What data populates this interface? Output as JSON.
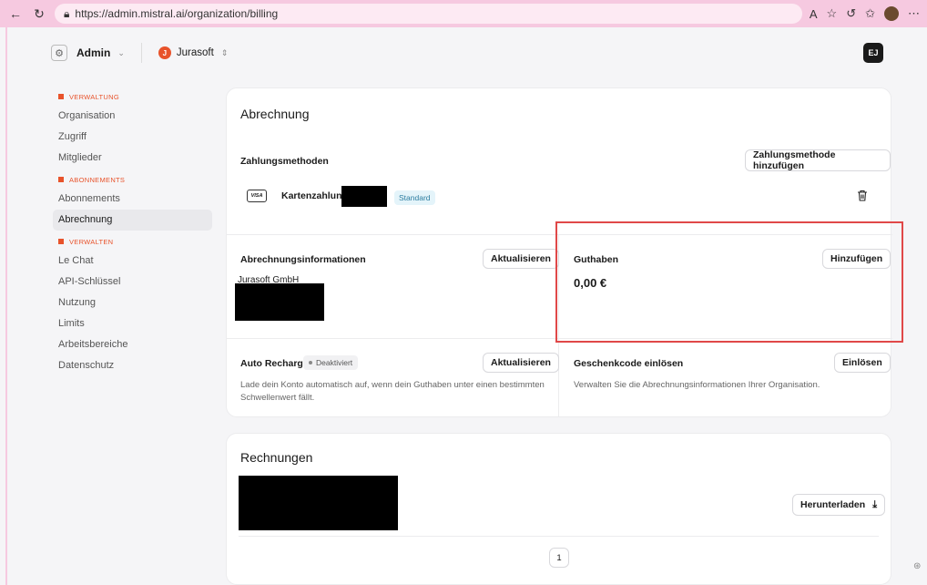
{
  "browser": {
    "url": "https://admin.mistral.ai/organization/billing"
  },
  "topbar": {
    "workspace": "Admin",
    "org_initial": "J",
    "org_name": "Jurasoft",
    "user_initials": "EJ"
  },
  "sidebar": {
    "sections": [
      {
        "title": "VERWALTUNG",
        "items": [
          "Organisation",
          "Zugriff",
          "Mitglieder"
        ]
      },
      {
        "title": "ABONNEMENTS",
        "items": [
          "Abonnements",
          "Abrechnung"
        ]
      },
      {
        "title": "VERWALTEN",
        "items": [
          "Le Chat",
          "API-Schlüssel",
          "Nutzung",
          "Limits",
          "Arbeitsbereiche",
          "Datenschutz"
        ]
      }
    ],
    "active": "Abrechnung"
  },
  "billing": {
    "title": "Abrechnung",
    "payment_methods_label": "Zahlungsmethoden",
    "add_payment_method": "Zahlungsmethode hinzufügen",
    "card_brand": "VISA",
    "card_label": "Kartenzahlung",
    "default_badge": "Standard",
    "billing_info_label": "Abrechnungsinformationen",
    "update_label": "Aktualisieren",
    "company": "Jurasoft GmbH",
    "credit_label": "Guthaben",
    "add_label": "Hinzufügen",
    "credit_amount": "0,00 €",
    "auto_recharge_label": "Auto Recharge",
    "auto_recharge_status": "Deaktiviert",
    "auto_recharge_desc": "Lade dein Konto automatisch auf, wenn dein Guthaben unter einen bestimmten Schwellenwert fällt.",
    "gift_label": "Geschenkcode einlösen",
    "redeem_label": "Einlösen",
    "gift_desc": "Verwalten Sie die Abrechnungsinformationen Ihrer Organisation."
  },
  "invoices": {
    "title": "Rechnungen",
    "download_label": "Herunterladen",
    "page": "1"
  },
  "colors": {
    "accent": "#e8532b",
    "highlight": "#e04848"
  }
}
